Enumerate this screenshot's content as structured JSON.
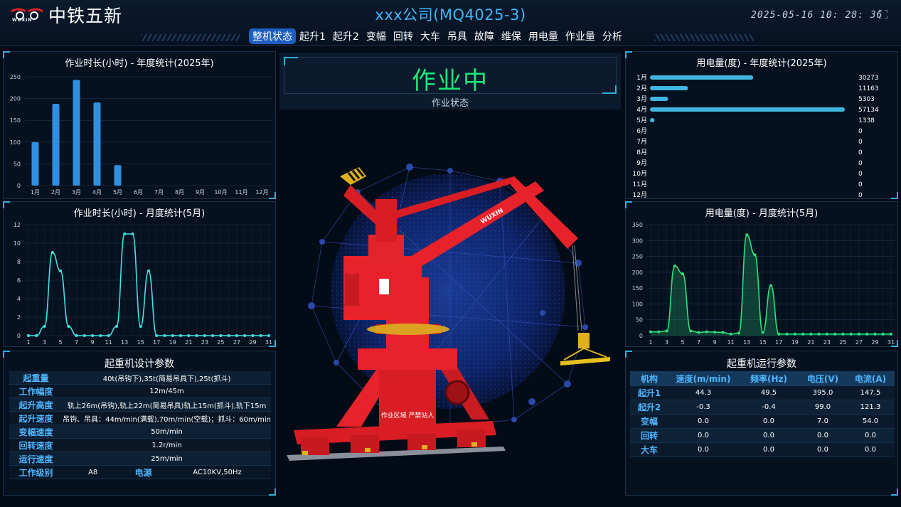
{
  "header": {
    "logo_text": "中铁五新",
    "logo_sub": "WUXIN",
    "title": "xxx公司(MQ4025-3)",
    "datetime": "2025-05-16 10: 28: 36"
  },
  "nav": {
    "items": [
      "整机状态",
      "起升1",
      "起升2",
      "变幅",
      "回转",
      "大车",
      "吊具",
      "故障",
      "维保",
      "用电量",
      "作业量",
      "分析"
    ],
    "active": 0
  },
  "colors": {
    "accent": "#3db7ff",
    "status_green": "#1de87a",
    "bar_blue": "#2f8fe0",
    "line_cyan": "#3ee3e6",
    "line_green": "#2ee07a",
    "crane_red": "#e8222a"
  },
  "annual_hours": {
    "title": "作业时长(小时) - 年度统计(2025年)"
  },
  "monthly_hours": {
    "title": "作业时长(小时) - 月度统计(5月)"
  },
  "annual_power": {
    "title": "用电量(度) - 年度统计(2025年)"
  },
  "monthly_power": {
    "title": "用电量(度) - 月度统计(5月)"
  },
  "chart_data": [
    {
      "id": "annual_hours",
      "type": "bar",
      "categories": [
        "1月",
        "2月",
        "3月",
        "4月",
        "5月",
        "6月",
        "7月",
        "8月",
        "9月",
        "10月",
        "11月",
        "12月"
      ],
      "values": [
        100,
        188,
        243,
        191,
        47,
        0,
        0,
        0,
        0,
        0,
        0,
        0
      ],
      "ylim": [
        0,
        250
      ],
      "yticks": [
        0,
        50,
        100,
        150,
        200,
        250
      ],
      "grid": true,
      "legend": "none"
    },
    {
      "id": "monthly_hours",
      "type": "line",
      "x": [
        1,
        2,
        3,
        4,
        5,
        6,
        7,
        8,
        9,
        10,
        11,
        12,
        13,
        14,
        15,
        16,
        17,
        18,
        19,
        20,
        21,
        22,
        23,
        24,
        25,
        26,
        27,
        28,
        29,
        30,
        31
      ],
      "xticks": [
        1,
        3,
        5,
        7,
        9,
        11,
        13,
        15,
        17,
        19,
        21,
        23,
        25,
        27,
        29,
        31
      ],
      "values": [
        0,
        0,
        1,
        9,
        7,
        1,
        0,
        0,
        0,
        0,
        0,
        1,
        11,
        11,
        1,
        7,
        0,
        0,
        0,
        0,
        0,
        0,
        0,
        0,
        0,
        0,
        0,
        0,
        0,
        0,
        0
      ],
      "ylim": [
        0,
        12
      ],
      "yticks": [
        0,
        2,
        4,
        6,
        8,
        10,
        12
      ],
      "grid": true,
      "legend": "none"
    },
    {
      "id": "annual_power",
      "type": "bar",
      "orientation": "horizontal",
      "categories": [
        "1月",
        "2月",
        "3月",
        "4月",
        "5月",
        "6月",
        "7月",
        "8月",
        "9月",
        "10月",
        "11月",
        "12月"
      ],
      "values": [
        30273,
        11163,
        5303,
        57134,
        1338,
        0,
        0,
        0,
        0,
        0,
        0,
        0
      ],
      "xlim": [
        0,
        57134
      ],
      "legend": "none"
    },
    {
      "id": "monthly_power",
      "type": "area",
      "x": [
        1,
        2,
        3,
        4,
        5,
        6,
        7,
        8,
        9,
        10,
        11,
        12,
        13,
        14,
        15,
        16,
        17,
        18,
        19,
        20,
        21,
        22,
        23,
        24,
        25,
        26,
        27,
        28,
        29,
        30,
        31
      ],
      "xticks": [
        1,
        3,
        5,
        7,
        9,
        11,
        13,
        15,
        17,
        19,
        21,
        23,
        25,
        27,
        29,
        31
      ],
      "values": [
        12,
        12,
        15,
        220,
        195,
        15,
        10,
        12,
        11,
        10,
        5,
        8,
        318,
        255,
        10,
        158,
        5,
        5,
        5,
        5,
        5,
        5,
        5,
        5,
        5,
        5,
        5,
        5,
        5,
        5,
        5
      ],
      "ylim": [
        0,
        350
      ],
      "yticks": [
        0,
        50,
        100,
        150,
        200,
        250,
        300,
        350
      ],
      "grid": true,
      "legend": "none"
    }
  ],
  "center": {
    "status": "作业中",
    "status_label": "作业状态",
    "crane_sign": "作业区域 严禁站人",
    "crane_brand": "WUXIN"
  },
  "design_params": {
    "title": "起重机设计参数",
    "rows": [
      {
        "key": "起重量",
        "value": "40t(吊钩下),35t(简易吊具下),25t(抓斗)"
      },
      {
        "key": "工作幅度",
        "value": "12m/45m"
      },
      {
        "key": "起升高度",
        "value": "轨上26m(吊钩),轨上22m(简易吊具)轨上15m(抓斗),轨下15m"
      },
      {
        "key": "起升速度",
        "value": "吊钩、吊具：44m/min(满载),70m/min(空载)；抓斗：60m/min"
      },
      {
        "key": "变幅速度",
        "value": "50m/min"
      },
      {
        "key": "回转速度",
        "value": "1.2r/min"
      },
      {
        "key": "运行速度",
        "value": "25m/min"
      }
    ],
    "last_row": {
      "key": "工作级别",
      "value": "A8",
      "key2": "电源",
      "value2": "AC10KV,50Hz"
    }
  },
  "run_params": {
    "title": "起重机运行参数",
    "headers": [
      "机构",
      "速度(m/min)",
      "频率(Hz)",
      "电压(V)",
      "电流(A)"
    ],
    "rows": [
      [
        "起升1",
        "44.3",
        "49.5",
        "395.0",
        "147.5"
      ],
      [
        "起升2",
        "-0.3",
        "-0.4",
        "99.0",
        "121.3"
      ],
      [
        "变幅",
        "0.0",
        "0.0",
        "7.0",
        "54.0"
      ],
      [
        "回转",
        "0.0",
        "0.0",
        "0.0",
        "0.0"
      ],
      [
        "大车",
        "0.0",
        "0.0",
        "0.0",
        "0.0"
      ]
    ]
  }
}
